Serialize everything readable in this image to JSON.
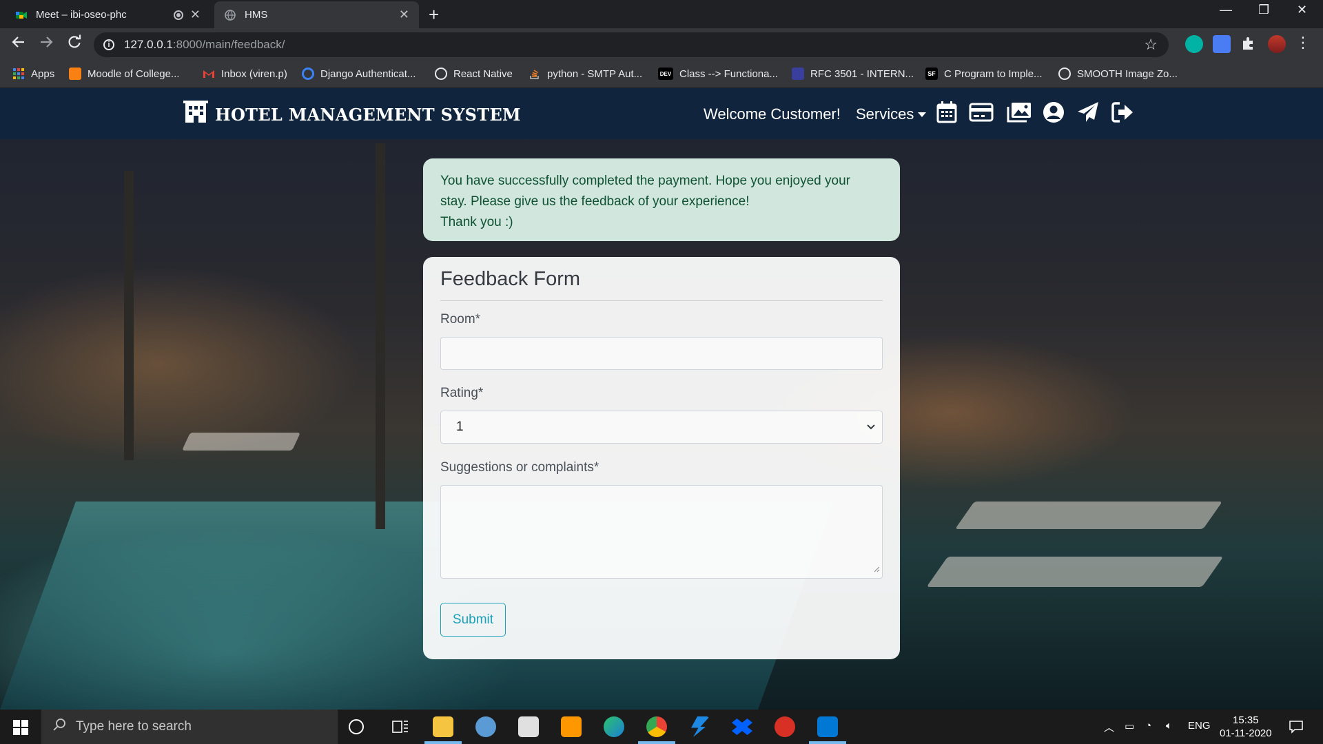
{
  "browser": {
    "tabs": [
      {
        "title": "Meet – ibi-oseo-phc",
        "icon": "google-meet-icon",
        "active": false
      },
      {
        "title": "HMS",
        "icon": "globe-icon",
        "active": true
      }
    ],
    "url_host": "127.0.0.1",
    "url_path": ":8000/main/feedback/",
    "bookmarks": [
      {
        "label": "Apps",
        "icon": "apps-grid-icon"
      },
      {
        "label": "Moodle of College...",
        "icon": "moodle-icon"
      },
      {
        "label": "Inbox (viren.p)",
        "icon": "gmail-icon"
      },
      {
        "label": "Django Authenticat...",
        "icon": "django-icon"
      },
      {
        "label": "React Native",
        "icon": "globe-icon"
      },
      {
        "label": "python - SMTP Aut...",
        "icon": "stackoverflow-icon"
      },
      {
        "label": "Class --> Functiona...",
        "icon": "dev-icon"
      },
      {
        "label": "RFC 3501 - INTERN...",
        "icon": "rfc-icon"
      },
      {
        "label": "C Program to Imple...",
        "icon": "sf-icon"
      },
      {
        "label": "SMOOTH Image Zo...",
        "icon": "globe-icon"
      }
    ]
  },
  "navbar": {
    "brand": "HOTEL MANAGEMENT SYSTEM",
    "welcome": "Welcome Customer!",
    "services": "Services",
    "icons": [
      "calendar-icon",
      "credit-card-icon",
      "images-icon",
      "user-circle-icon",
      "paper-plane-icon",
      "sign-out-icon"
    ]
  },
  "alert": {
    "line1": "You have successfully completed the payment. Hope you enjoyed your",
    "line2": "stay. Please give us the feedback of your experience!",
    "line3": "Thank you :)"
  },
  "form": {
    "title": "Feedback Form",
    "room_label": "Room*",
    "room_value": "",
    "rating_label": "Rating*",
    "rating_value": "1",
    "suggestions_label": "Suggestions or complaints*",
    "suggestions_value": "",
    "submit_label": "Submit"
  },
  "taskbar": {
    "search_placeholder": "Type here to search",
    "language": "ENG",
    "time": "15:35",
    "date": "01-11-2020"
  },
  "colors": {
    "navbar": "#10243e",
    "alert_bg": "#d1e7dd",
    "alert_text": "#0f5132",
    "submit": "#17a2b8"
  }
}
